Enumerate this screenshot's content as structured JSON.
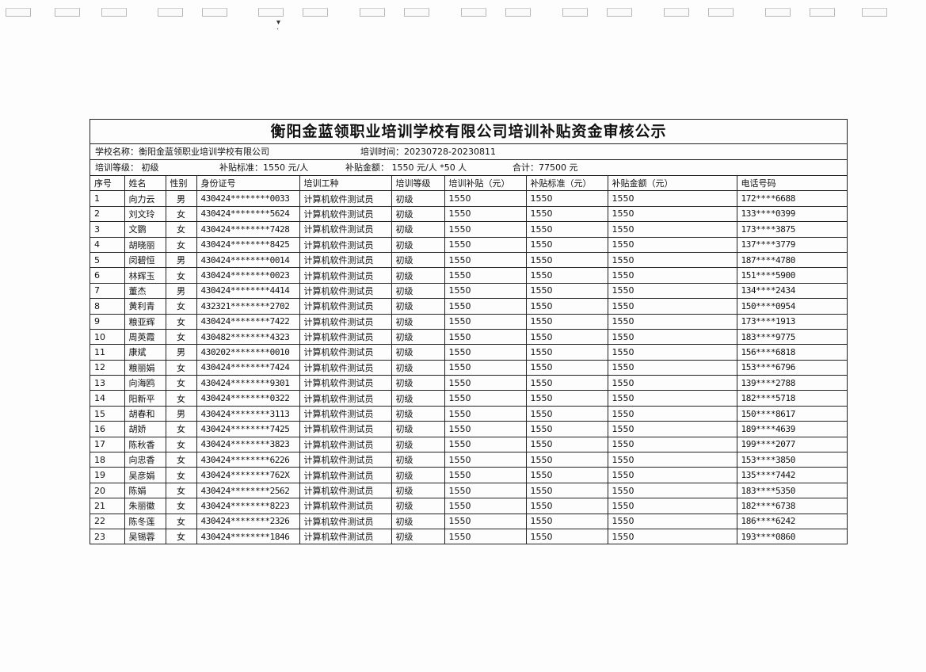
{
  "document": {
    "title": "衡阳金蓝领职业培训学校有限公司培训补贴资金审核公示",
    "info": {
      "school": "学校名称：衡阳金蓝领职业培训学校有限公司",
      "period": "培训时间：20230728-20230811",
      "level": "培训等级：    初级",
      "standard": "补贴标准：1550 元/人",
      "amount": "补贴金额：  1550 元/人 *50 人",
      "total": "合计：77500   元"
    },
    "columns": [
      "序号",
      "姓名",
      "性别",
      "身份证号",
      "培训工种",
      "培训等级",
      "培训补贴（元）",
      "补贴标准（元）",
      "补贴金额（元）",
      "电话号码"
    ],
    "rows": [
      [
        "1",
        "向力云",
        "男",
        "430424********0033",
        "计算机软件测试员",
        "初级",
        "1550",
        "1550",
        "1550",
        "172****6688"
      ],
      [
        "2",
        "刘文玲",
        "女",
        "430424********5624",
        "计算机软件测试员",
        "初级",
        "1550",
        "1550",
        "1550",
        "133****0399"
      ],
      [
        "3",
        "文鹦",
        "女",
        "430424********7428",
        "计算机软件测试员",
        "初级",
        "1550",
        "1550",
        "1550",
        "173****3875"
      ],
      [
        "4",
        "胡晓丽",
        "女",
        "430424********8425",
        "计算机软件测试员",
        "初级",
        "1550",
        "1550",
        "1550",
        "137****3779"
      ],
      [
        "5",
        "闵碧恒",
        "男",
        "430424********0014",
        "计算机软件测试员",
        "初级",
        "1550",
        "1550",
        "1550",
        "187****4780"
      ],
      [
        "6",
        "林辉玉",
        "女",
        "430424********0023",
        "计算机软件测试员",
        "初级",
        "1550",
        "1550",
        "1550",
        "151****5900"
      ],
      [
        "7",
        "董杰",
        "男",
        "430424********4414",
        "计算机软件测试员",
        "初级",
        "1550",
        "1550",
        "1550",
        "134****2434"
      ],
      [
        "8",
        "黄利青",
        "女",
        "432321********2702",
        "计算机软件测试员",
        "初级",
        "1550",
        "1550",
        "1550",
        "150****0954"
      ],
      [
        "9",
        "粮亚辉",
        "女",
        "430424********7422",
        "计算机软件测试员",
        "初级",
        "1550",
        "1550",
        "1550",
        "173****1913"
      ],
      [
        "10",
        "周英霞",
        "女",
        "430482********4323",
        "计算机软件测试员",
        "初级",
        "1550",
        "1550",
        "1550",
        "183****9775"
      ],
      [
        "11",
        "康斌",
        "男",
        "430202********0010",
        "计算机软件测试员",
        "初级",
        "1550",
        "1550",
        "1550",
        "156****6818"
      ],
      [
        "12",
        "粮丽娟",
        "女",
        "430424********7424",
        "计算机软件测试员",
        "初级",
        "1550",
        "1550",
        "1550",
        "153****6796"
      ],
      [
        "13",
        "向海鸥",
        "女",
        "430424********9301",
        "计算机软件测试员",
        "初级",
        "1550",
        "1550",
        "1550",
        "139****2788"
      ],
      [
        "14",
        "阳新平",
        "女",
        "430424********0322",
        "计算机软件测试员",
        "初级",
        "1550",
        "1550",
        "1550",
        "182****5718"
      ],
      [
        "15",
        "胡春和",
        "男",
        "430424********3113",
        "计算机软件测试员",
        "初级",
        "1550",
        "1550",
        "1550",
        "150****8617"
      ],
      [
        "16",
        "胡娇",
        "女",
        "430424********7425",
        "计算机软件测试员",
        "初级",
        "1550",
        "1550",
        "1550",
        "189****4639"
      ],
      [
        "17",
        "陈秋香",
        "女",
        "430424********3823",
        "计算机软件测试员",
        "初级",
        "1550",
        "1550",
        "1550",
        "199****2077"
      ],
      [
        "18",
        "向忠香",
        "女",
        "430424********6226",
        "计算机软件测试员",
        "初级",
        "1550",
        "1550",
        "1550",
        "153****3850"
      ],
      [
        "19",
        "吴彦娟",
        "女",
        "430424********762X",
        "计算机软件测试员",
        "初级",
        "1550",
        "1550",
        "1550",
        "135****7442"
      ],
      [
        "20",
        "陈娟",
        "女",
        "430424********2562",
        "计算机软件测试员",
        "初级",
        "1550",
        "1550",
        "1550",
        "183****5350"
      ],
      [
        "21",
        "朱丽徽",
        "女",
        "430424********8223",
        "计算机软件测试员",
        "初级",
        "1550",
        "1550",
        "1550",
        "182****6738"
      ],
      [
        "22",
        "陈冬莲",
        "女",
        "430424********2326",
        "计算机软件测试员",
        "初级",
        "1550",
        "1550",
        "1550",
        "186****6242"
      ],
      [
        "23",
        "吴锡蓉",
        "女",
        "430424********1846",
        "计算机软件测试员",
        "初级",
        "1550",
        "1550",
        "1550",
        "193****0860"
      ]
    ]
  }
}
